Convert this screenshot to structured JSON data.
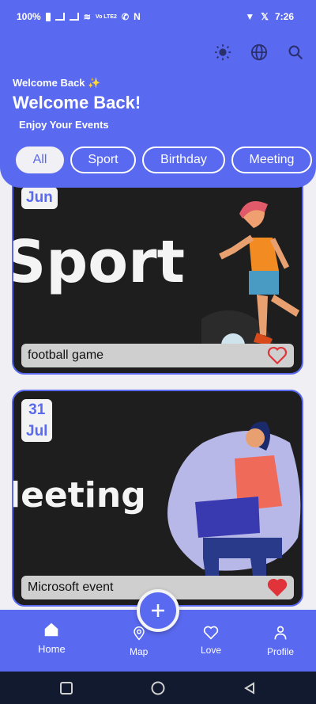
{
  "status_bar": {
    "battery": "100%",
    "signal_text": "Vo LTE2",
    "network_icon": "N",
    "time": "7:26"
  },
  "header": {
    "welcome_small": "Welcome Back ✨",
    "welcome_big": "Welcome Back!",
    "subtitle": "Enjoy Your Events",
    "icons": [
      "sun-icon",
      "globe-icon",
      "search-icon"
    ]
  },
  "categories": [
    {
      "label": "All",
      "active": true
    },
    {
      "label": "Sport",
      "active": false
    },
    {
      "label": "Birthday",
      "active": false
    },
    {
      "label": "Meeting",
      "active": false
    }
  ],
  "events": [
    {
      "date_line1": "Jun",
      "date_line2": "",
      "big_text": "Sport",
      "title": "football game",
      "favorite": false
    },
    {
      "date_line1": "31",
      "date_line2": "Jul",
      "big_text": "leeting",
      "title": "Microsoft event",
      "favorite": true
    }
  ],
  "bottom_nav": {
    "items": [
      {
        "label": "Home",
        "icon": "home-icon"
      },
      {
        "label": "Map",
        "icon": "map-pin-icon"
      },
      {
        "label": "Love",
        "icon": "heart-icon"
      },
      {
        "label": "Profile",
        "icon": "person-icon"
      }
    ],
    "fab_icon": "plus-icon"
  },
  "colors": {
    "primary": "#5a6af0",
    "card_bg": "#1e1e1e",
    "heart": "#e0333a"
  }
}
